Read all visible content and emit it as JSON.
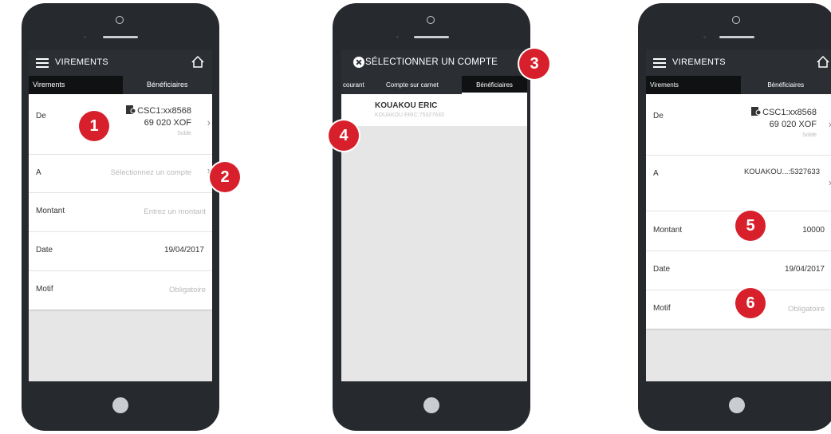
{
  "colors": {
    "phone": "#262a2f",
    "bar": "#2b2f34",
    "active_tab": "#0f1113",
    "badge": "#d7202b",
    "screen_bg": "#e6e6e6"
  },
  "screen1": {
    "title": "VIREMENTS",
    "tabs": [
      "Virements",
      "Bénéficiaires"
    ],
    "de": {
      "label": "De",
      "account": "CSC1:xx8568",
      "amount": "69 020 XOF",
      "caption": "Solde"
    },
    "a": {
      "label": "A",
      "placeholder": "Sélectionnez un compte"
    },
    "montant": {
      "label": "Montant",
      "placeholder": "Entrez un montant"
    },
    "date": {
      "label": "Date",
      "value": "19/04/2017"
    },
    "motif": {
      "label": "Motif",
      "placeholder": "Obligatoire"
    }
  },
  "screen2": {
    "title": "SÉLECTIONNER UN COMPTE",
    "tabs": [
      "courant",
      "Compte sur carnet",
      "Bénéficiaires"
    ],
    "beneficiary": {
      "name": "KOUAKOU ERIC",
      "detail": "KOUAKOU ERIC:75327633"
    }
  },
  "screen3": {
    "title": "VIREMENTS",
    "tabs": [
      "Virements",
      "Bénéficiaires"
    ],
    "de": {
      "label": "De",
      "account": "CSC1:xx8568",
      "amount": "69 020 XOF",
      "caption": "Solde"
    },
    "a": {
      "label": "A",
      "value": "KOUAKOU...:5327633"
    },
    "montant": {
      "label": "Montant",
      "value": "10000"
    },
    "date": {
      "label": "Date",
      "value": "19/04/2017"
    },
    "motif": {
      "label": "Motif",
      "placeholder": "Obligatoire"
    }
  },
  "badges": [
    "1",
    "2",
    "3",
    "4",
    "5",
    "6"
  ]
}
